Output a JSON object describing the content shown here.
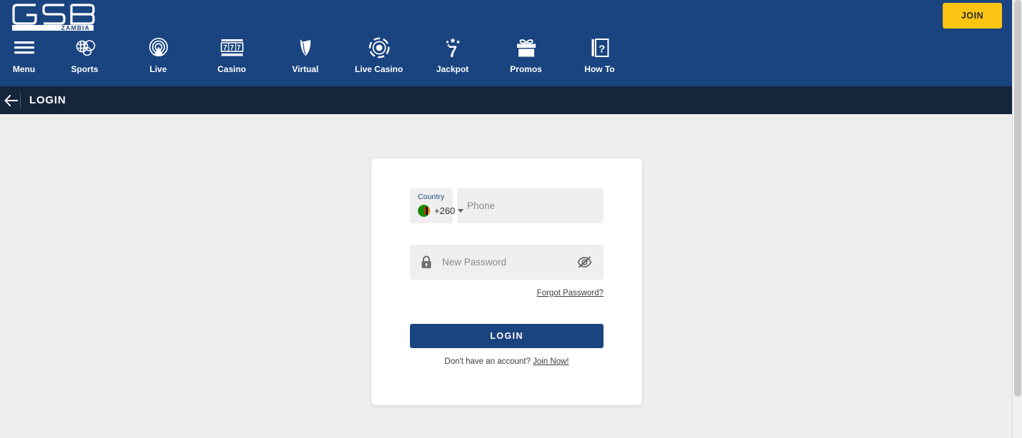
{
  "header": {
    "logo": {
      "name": "GSB",
      "sub": "ZAMBIA"
    },
    "join_label": "JOIN",
    "nav": [
      {
        "label": "Menu",
        "icon": "hamburger-menu-icon"
      },
      {
        "label": "Sports",
        "icon": "sports-balls-icon"
      },
      {
        "label": "Live",
        "icon": "live-broadcast-icon"
      },
      {
        "label": "Casino",
        "icon": "slot-machine-777-icon"
      },
      {
        "label": "Virtual",
        "icon": "virtual-v-icon"
      },
      {
        "label": "Live Casino",
        "icon": "poker-chip-icon"
      },
      {
        "label": "Jackpot",
        "icon": "lucky-seven-stars-icon"
      },
      {
        "label": "Promos",
        "icon": "gift-box-icon"
      },
      {
        "label": "How To",
        "icon": "book-question-icon"
      }
    ]
  },
  "subbar": {
    "back_icon": "back-arrow-icon",
    "title": "LOGIN"
  },
  "login_form": {
    "country": {
      "label": "Country",
      "dial_code": "+260",
      "flag": "zambia-flag-icon"
    },
    "phone_placeholder": "Phone",
    "password_placeholder": "New Password",
    "password_value": "",
    "lock_icon": "lock-icon",
    "eye_icon": "eye-off-icon",
    "forgot_label": "Forgot Password?",
    "submit_label": "LOGIN",
    "signup_prompt": "Don't have an account?",
    "signup_link": "Join Now!"
  },
  "colors": {
    "header_blue": "#1a4480",
    "subbar_navy": "#15253c",
    "join_yellow": "#fbc412",
    "page_bg": "#eeeeee",
    "input_bg": "#efefef"
  }
}
